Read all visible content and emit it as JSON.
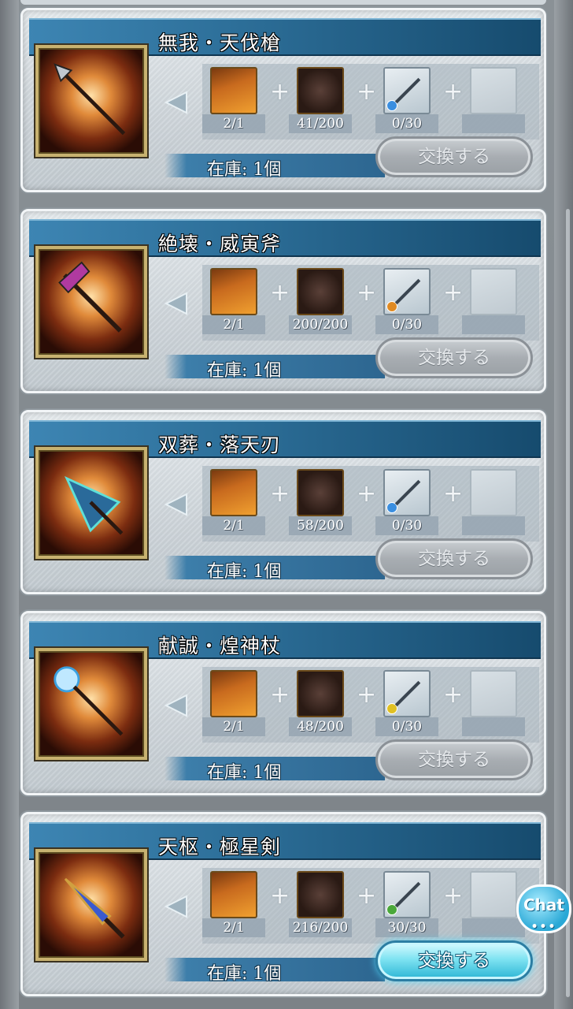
{
  "items": [
    {
      "title": "無我・天伐槍",
      "counts": [
        "2/1",
        "41/200",
        "0/30"
      ],
      "stock": "在庫: 1個",
      "button": "交換する",
      "button_active": false,
      "weapon_type": "spear-icon",
      "element_color": "#3a8ee0"
    },
    {
      "title": "絶壊・威寅斧",
      "counts": [
        "2/1",
        "200/200",
        "0/30"
      ],
      "stock": "在庫: 1個",
      "button": "交換する",
      "button_active": false,
      "weapon_type": "axe-icon",
      "element_color": "#e08a22"
    },
    {
      "title": "双葬・落天刃",
      "counts": [
        "2/1",
        "58/200",
        "0/30"
      ],
      "stock": "在庫: 1個",
      "button": "交換する",
      "button_active": false,
      "weapon_type": "dagger-icon",
      "element_color": "#3a8ee0"
    },
    {
      "title": "献誠・煌神杖",
      "counts": [
        "2/1",
        "48/200",
        "0/30"
      ],
      "stock": "在庫: 1個",
      "button": "交換する",
      "button_active": false,
      "weapon_type": "staff-icon",
      "element_color": "#e0c022"
    },
    {
      "title": "天枢・極星剣",
      "counts": [
        "2/1",
        "216/200",
        "30/30"
      ],
      "stock": "在庫: 1個",
      "button": "交換する",
      "button_active": true,
      "weapon_type": "sword-icon",
      "element_color": "#4aa83a"
    }
  ],
  "chat": {
    "label": "Chat",
    "dots": "•••"
  }
}
